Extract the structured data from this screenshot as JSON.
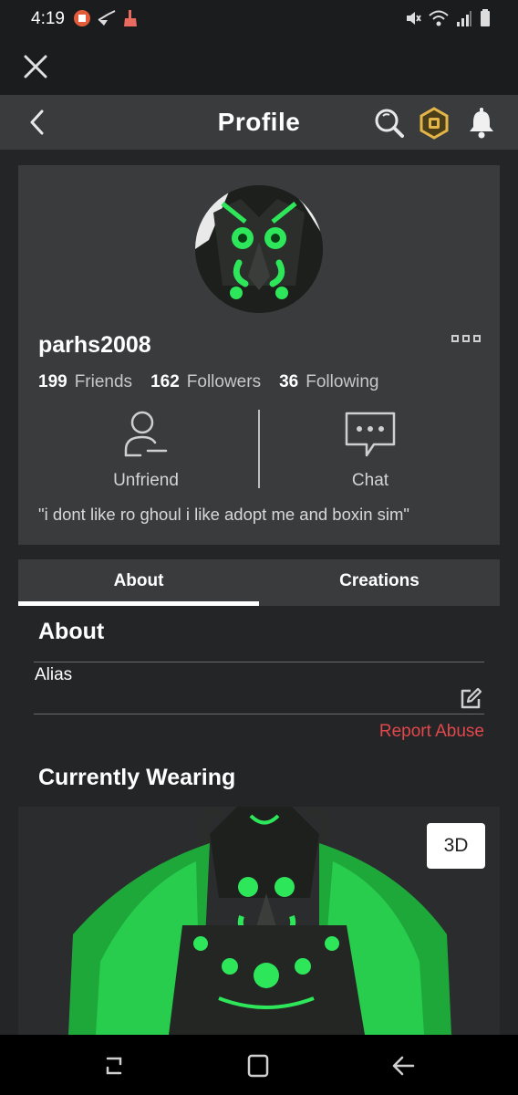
{
  "status_bar": {
    "time": "4:19"
  },
  "nav": {
    "title": "Profile"
  },
  "profile": {
    "username": "parhs2008",
    "friends_count": "199",
    "friends_label": "Friends",
    "followers_count": "162",
    "followers_label": "Followers",
    "following_count": "36",
    "following_label": "Following",
    "unfriend_label": "Unfriend",
    "chat_label": "Chat",
    "blurb": "\"i dont like ro ghoul i like adopt me and boxin sim\""
  },
  "tabs": [
    {
      "label": "About",
      "active": true
    },
    {
      "label": "Creations",
      "active": false
    }
  ],
  "about": {
    "title": "About",
    "alias_label": "Alias",
    "report_label": "Report Abuse"
  },
  "wearing": {
    "title": "Currently Wearing",
    "toggle_3d_label": "3D"
  },
  "colors": {
    "background": "#232527",
    "card": "#393b3d",
    "report": "#e2474b",
    "accent_green": "#2ee65a"
  }
}
